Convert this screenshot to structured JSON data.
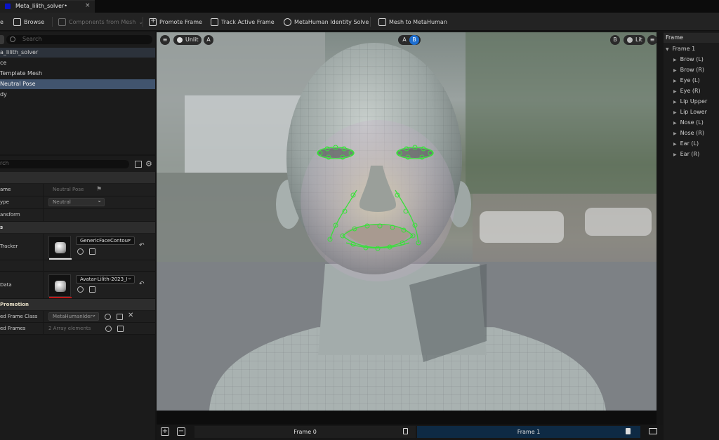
{
  "tab": {
    "title": "Meta_lilith_solver•",
    "close": "×"
  },
  "toolbar": {
    "partial_label": "e",
    "browse": "Browse",
    "components_from_mesh": "Components from Mesh",
    "promote_frame": "Promote Frame",
    "track_active_frame": "Track Active Frame",
    "identity_solve": "MetaHuman Identity Solve",
    "mesh_to_metahuman": "Mesh to MetaHuman"
  },
  "outliner": {
    "search_placeholder": "Search",
    "items": [
      {
        "label": "a_lilith_solver"
      },
      {
        "label": "ce"
      },
      {
        "label": "Template Mesh"
      },
      {
        "label": "Neutral Pose"
      },
      {
        "label": "dy"
      }
    ]
  },
  "details": {
    "search_placeholder": "rch",
    "rows": {
      "name_label": "ame",
      "name_value": "Neutral Pose",
      "type_label": "ype",
      "type_value": "Neutral",
      "transform_label": "ansform",
      "section_s": "s",
      "tracker_label": "Tracker",
      "tracker_value": "GenericFaceContour",
      "data_label": "Data",
      "data_value": "Avatar-Lilith-2023_I",
      "promotion_label": "Promotion",
      "frame_class_label": "ed Frame Class",
      "frame_class_value": "MetaHumanIder",
      "frames_label": "ed Frames",
      "frames_value": "2 Array elements"
    },
    "accent_red": "#c01818",
    "accent_white": "#e0e0e0"
  },
  "viewport": {
    "view_mode": "Unlit",
    "slot_a": "A",
    "ab_a": "A",
    "ab_b": "B",
    "slot_b": "B",
    "lit_mode": "Lit",
    "tracker_color": "#38e03a"
  },
  "frames_bar": {
    "frame0": "Frame 0",
    "frame1": "Frame 1"
  },
  "right_panel": {
    "header": "Frame",
    "root": "Frame 1",
    "items": [
      "Brow (L)",
      "Brow (R)",
      "Eye (L)",
      "Eye (R)",
      "Lip Upper",
      "Lip Lower",
      "Nose (L)",
      "Nose (R)",
      "Ear (L)",
      "Ear (R)"
    ]
  }
}
